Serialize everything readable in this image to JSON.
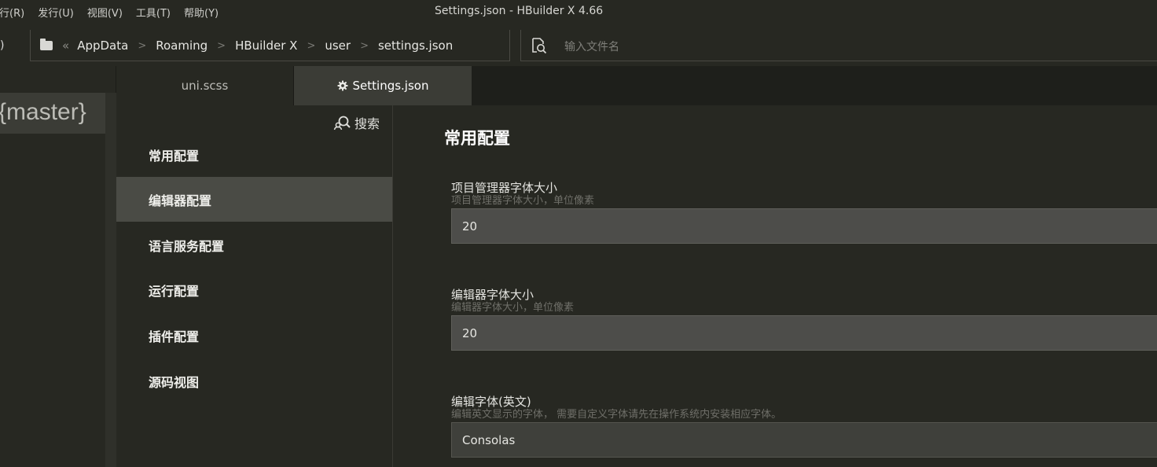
{
  "menu": [
    "行(R)",
    "发行(U)",
    "视图(V)",
    "工具(T)",
    "帮助(Y)"
  ],
  "window_title": "Settings.json - HBuilder X 4.66",
  "address": {
    "left_fragment": ")",
    "crumbs": [
      "AppData",
      "Roaming",
      "HBuilder X",
      "user",
      "settings.json"
    ],
    "search_placeholder": "输入文件名"
  },
  "project": {
    "branch": "{master}"
  },
  "tabs": [
    {
      "label": "uni.scss"
    },
    {
      "label": "Settings.json",
      "icon": "gear-icon",
      "active": true
    }
  ],
  "nav": {
    "search_label": "搜索",
    "items": [
      "常用配置",
      "编辑器配置",
      "语言服务配置",
      "运行配置",
      "插件配置",
      "源码视图"
    ],
    "active_index": 1
  },
  "content": {
    "section_title": "常用配置",
    "settings": [
      {
        "label": "项目管理器字体大小",
        "desc": "项目管理器字体大小，单位像素",
        "value": "20"
      },
      {
        "label": "编辑器字体大小",
        "desc": "编辑器字体大小，单位像素",
        "value": "20"
      },
      {
        "label": "编辑字体(英文)",
        "desc": "编辑英文显示的字体， 需要自定义字体请先在操作系统内安装相应字体。",
        "value": "Consolas"
      }
    ]
  },
  "colors": {
    "background": "#272822",
    "active_tab": "#3b3c36",
    "active_nav": "#4a4b45",
    "input_bg": "#4d4d4a"
  }
}
